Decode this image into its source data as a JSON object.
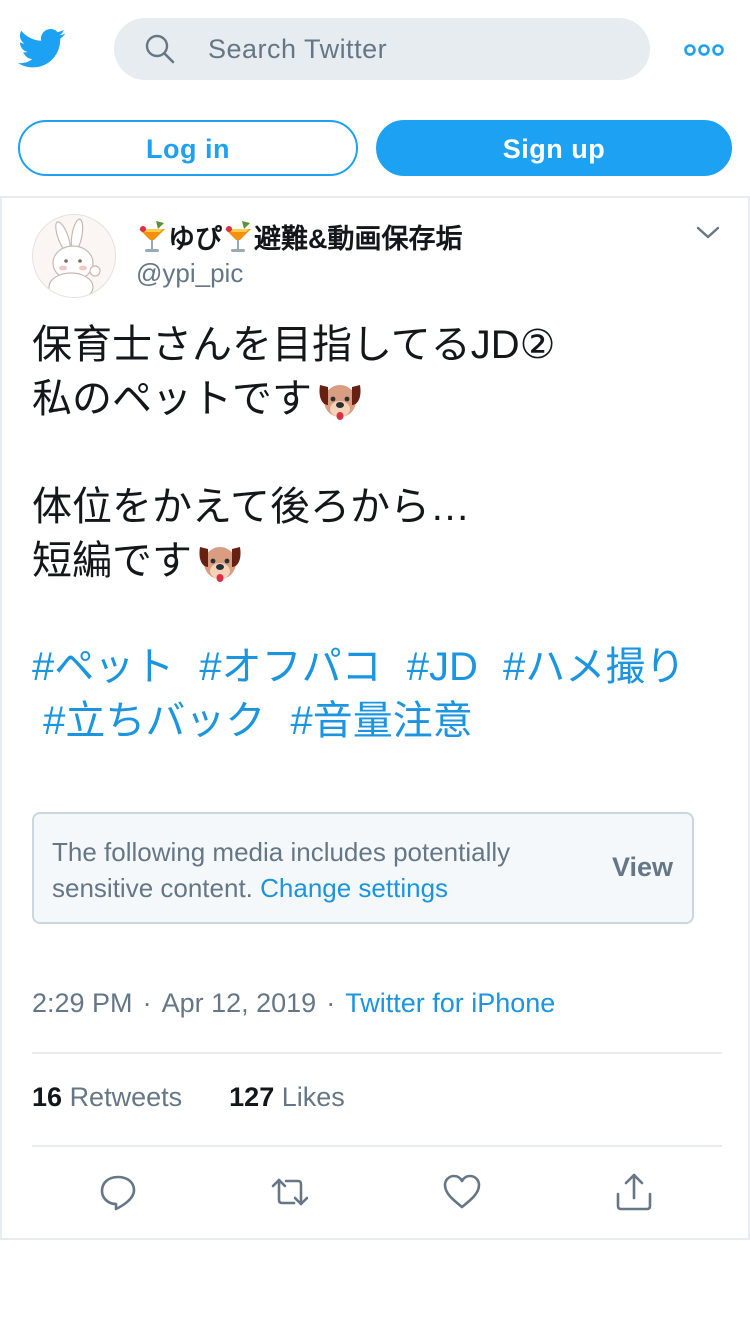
{
  "colors": {
    "brand": "#1da1f2",
    "link": "#1b95e0",
    "muted": "#657786",
    "text": "#14171a",
    "border": "#e6ecf0"
  },
  "header": {
    "logo_icon": "twitter-bird-icon",
    "search_placeholder": "Search Twitter",
    "more_icon": "more-dots-icon"
  },
  "auth": {
    "login_label": "Log in",
    "signup_label": "Sign up"
  },
  "tweet": {
    "display_name": "ゆぴ",
    "display_name_suffix": "避難&動画保存垢",
    "handle": "@ypi_pic",
    "text_lines": [
      "保育士さんを目指してるJD②",
      "私のペットです",
      "体位をかえて後ろから…",
      "短編です"
    ],
    "hashtags_line1": [
      "#ペット",
      "#オフパコ",
      "#JD",
      "#ハメ撮り"
    ],
    "hashtags_line2": [
      "#立ちバック",
      "#音量注意"
    ],
    "sensitive_notice": "The following media includes potentially sensitive content.",
    "change_settings": "Change settings",
    "view_label": "View",
    "time": "2:29 PM",
    "date": "Apr 12, 2019",
    "source": "Twitter for iPhone",
    "separator": "·",
    "retweets_count": "16",
    "retweets_label": "Retweets",
    "likes_count": "127",
    "likes_label": "Likes"
  }
}
